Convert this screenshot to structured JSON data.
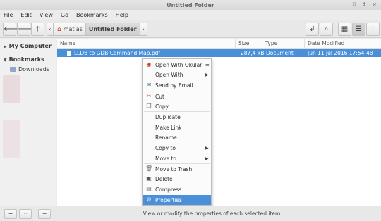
{
  "window": {
    "title": "Untitled Folder",
    "controls": [
      "⇩",
      "↕",
      "✕"
    ]
  },
  "menubar": [
    "File",
    "Edit",
    "View",
    "Go",
    "Bookmarks",
    "Help"
  ],
  "toolbar": {
    "back_icon": "back-arrow-icon",
    "forward_icon": "forward-arrow-icon",
    "up_icon": "up-arrow-icon",
    "breadcrumbs": [
      "matias",
      "Untitled Folder"
    ],
    "view_modes": [
      "icons",
      "list",
      "compact"
    ]
  },
  "sidebar": {
    "sections": [
      {
        "label": "My Computer"
      },
      {
        "label": "Bookmarks",
        "items": [
          "Downloads"
        ]
      }
    ]
  },
  "columns": [
    "Name",
    "Size",
    "Type",
    "Date Modified"
  ],
  "files": [
    {
      "name": "LLDB to GDB Command Map.pdf",
      "size": "287,4 kB",
      "type": "Document",
      "modified": "Jun 11 jul 2016 17:54:48 -03"
    }
  ],
  "context_menu": {
    "items": [
      {
        "label": "Open With Okular",
        "icon": "okular-icon",
        "arrow": "minus"
      },
      {
        "label": "Open With",
        "arrow": "right"
      },
      {
        "label": "Send by Email",
        "icon": "email-icon"
      },
      {
        "label": "Cut",
        "icon": "scissors-icon"
      },
      {
        "label": "Copy",
        "icon": "copy-icon"
      },
      {
        "label": "Duplicate"
      },
      {
        "label": "Make Link"
      },
      {
        "label": "Rename..."
      },
      {
        "label": "Copy to",
        "arrow": "right"
      },
      {
        "label": "Move to",
        "arrow": "right"
      },
      {
        "label": "Move to Trash",
        "icon": "trash-icon"
      },
      {
        "label": "Delete",
        "icon": "delete-icon"
      },
      {
        "label": "Compress...",
        "icon": "archive-icon"
      },
      {
        "label": "Properties",
        "icon": "gear-icon",
        "selected": true
      }
    ]
  },
  "status": "View or modify the properties of each selected item",
  "colors": {
    "selection": "#4a90d9",
    "home_icon": "#c23b2b"
  }
}
